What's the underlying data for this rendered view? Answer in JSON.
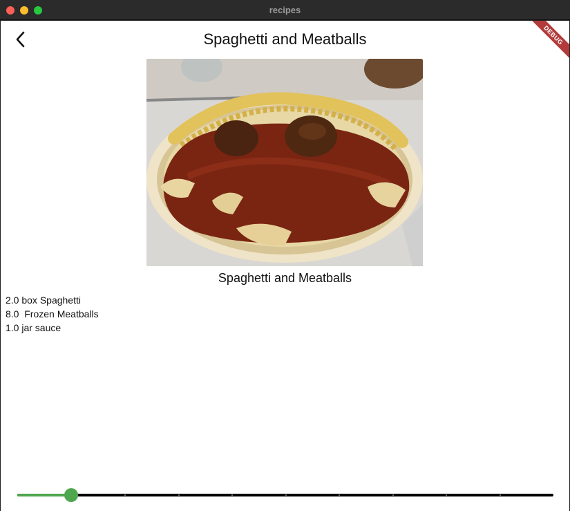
{
  "window": {
    "title": "recipes"
  },
  "appbar": {
    "title": "Spaghetti and Meatballs"
  },
  "debug_banner": "DEBUG",
  "recipe": {
    "caption": "Spaghetti and Meatballs",
    "ingredients": [
      "2.0 box Spaghetti",
      "8.0  Frozen Meatballs",
      "1.0 jar sauce"
    ]
  },
  "servings_slider": {
    "value_fraction": 0.1,
    "active_color": "#4ea64f",
    "divisions": 10
  }
}
